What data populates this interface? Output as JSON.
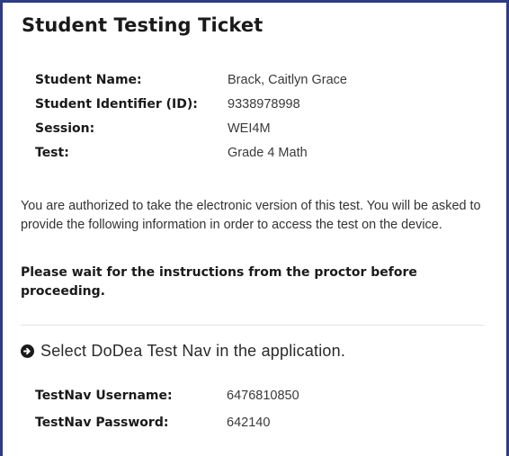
{
  "ticket": {
    "title": "Student Testing Ticket",
    "student_info": [
      {
        "label": "Student Name:",
        "value": "Brack, Caitlyn Grace"
      },
      {
        "label": "Student Identifier (ID):",
        "value": "9338978998"
      },
      {
        "label": "Session:",
        "value": "WEI4M"
      },
      {
        "label": "Test:",
        "value": "Grade 4 Math"
      }
    ],
    "authorization_text": "You are authorized to take the electronic version of this test. You will be asked to provide the following information in order to access the test on the device.",
    "proctor_notice": "Please wait for the instructions from the proctor before proceeding.",
    "instruction": {
      "icon": "circle-arrow-right-icon",
      "text": "Select DoDea Test Nav in the application."
    },
    "credentials": [
      {
        "label": "TestNav Username:",
        "value": "6476810850"
      },
      {
        "label": "TestNav Password:",
        "value": "642140"
      }
    ]
  },
  "colors": {
    "border": "#2e3c86",
    "divider": "#e3e3e3"
  }
}
